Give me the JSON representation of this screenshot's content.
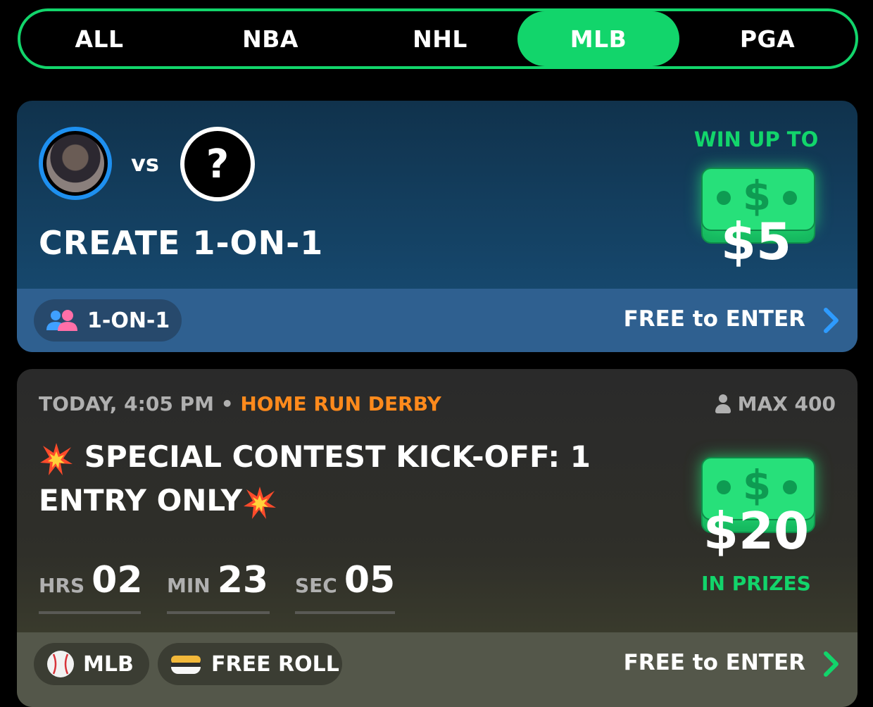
{
  "tabs": [
    {
      "label": "ALL",
      "active": false
    },
    {
      "label": "NBA",
      "active": false
    },
    {
      "label": "NHL",
      "active": false
    },
    {
      "label": "MLB",
      "active": true
    },
    {
      "label": "PGA",
      "active": false
    }
  ],
  "card1": {
    "vs": "vs",
    "mystery": "?",
    "title": "CREATE 1-ON-1",
    "win_label": "WIN UP TO",
    "prize": "$5",
    "chip_label": "1-ON-1",
    "enter": "FREE to ENTER"
  },
  "card2": {
    "time": "TODAY, 4:05 PM",
    "dot": "•",
    "contest_type": "HOME RUN DERBY",
    "max": "MAX 400",
    "title_part1": "SPECIAL CONTEST KICK-OFF: 1",
    "title_part2": "ENTRY ONLY",
    "timer": [
      {
        "unit": "HRS",
        "value": "02"
      },
      {
        "unit": "MIN",
        "value": "23"
      },
      {
        "unit": "SEC",
        "value": "05"
      }
    ],
    "prize": "$20",
    "prize_label": "IN PRIZES",
    "chip_league": "MLB",
    "chip_type": "FREE ROLL",
    "enter": "FREE to ENTER"
  },
  "colors": {
    "accent_green": "#12d56b",
    "accent_blue": "#1e90f0",
    "accent_orange": "#ff8a1c"
  }
}
